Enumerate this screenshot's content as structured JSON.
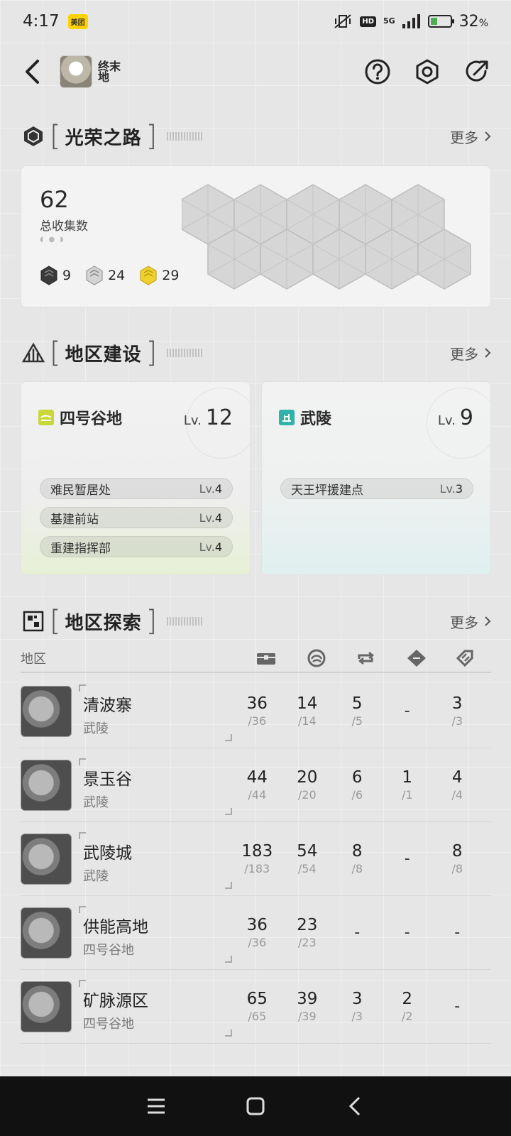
{
  "status_bar": {
    "time": "4:17",
    "app_badge": "美团",
    "hd": "HD",
    "network": "5G",
    "battery_percent": "32",
    "battery_unit": "%"
  },
  "header": {
    "game_logo_text": "终末地"
  },
  "glory": {
    "title": "光荣之路",
    "more": "更多",
    "total": "62",
    "total_label": "总收集数",
    "tiers": [
      {
        "icon": "dark-tier-icon",
        "count": "9",
        "color": "#3a3a3a"
      },
      {
        "icon": "silver-tier-icon",
        "count": "24",
        "color": "#c9c9c9"
      },
      {
        "icon": "gold-tier-icon",
        "count": "29",
        "color": "#f0d02c"
      }
    ]
  },
  "build": {
    "title": "地区建设",
    "more": "更多",
    "lv_prefix": "Lv.",
    "regions": [
      {
        "name": "四号谷地",
        "level": "12",
        "color": "#c8d83a",
        "facilities": [
          {
            "name": "难民暂居处",
            "lv_prefix": "Lv.",
            "level": "4"
          },
          {
            "name": "基建前站",
            "lv_prefix": "Lv.",
            "level": "4"
          },
          {
            "name": "重建指挥部",
            "lv_prefix": "Lv.",
            "level": "4"
          }
        ]
      },
      {
        "name": "武陵",
        "level": "9",
        "color": "#2fb3a8",
        "facilities": [
          {
            "name": "天王坪援建点",
            "lv_prefix": "Lv.",
            "level": "3"
          }
        ]
      }
    ]
  },
  "explore": {
    "title": "地区探索",
    "more": "更多",
    "region_header": "地区",
    "column_icons": [
      "chest-icon",
      "swirl-icon",
      "loop-icon",
      "diamond-icon",
      "tag-icon"
    ],
    "rows": [
      {
        "name": "清波寨",
        "area": "武陵",
        "cells": [
          {
            "v": "36",
            "t": "/36"
          },
          {
            "v": "14",
            "t": "/14"
          },
          {
            "v": "5",
            "t": "/5"
          },
          {
            "v": "-",
            "t": ""
          },
          {
            "v": "3",
            "t": "/3"
          }
        ]
      },
      {
        "name": "景玉谷",
        "area": "武陵",
        "cells": [
          {
            "v": "44",
            "t": "/44"
          },
          {
            "v": "20",
            "t": "/20"
          },
          {
            "v": "6",
            "t": "/6"
          },
          {
            "v": "1",
            "t": "/1"
          },
          {
            "v": "4",
            "t": "/4"
          }
        ]
      },
      {
        "name": "武陵城",
        "area": "武陵",
        "cells": [
          {
            "v": "183",
            "t": "/183"
          },
          {
            "v": "54",
            "t": "/54"
          },
          {
            "v": "8",
            "t": "/8"
          },
          {
            "v": "-",
            "t": ""
          },
          {
            "v": "8",
            "t": "/8"
          }
        ]
      },
      {
        "name": "供能高地",
        "area": "四号谷地",
        "cells": [
          {
            "v": "36",
            "t": "/36"
          },
          {
            "v": "23",
            "t": "/23"
          },
          {
            "v": "-",
            "t": ""
          },
          {
            "v": "-",
            "t": ""
          },
          {
            "v": "-",
            "t": ""
          }
        ]
      },
      {
        "name": "矿脉源区",
        "area": "四号谷地",
        "cells": [
          {
            "v": "65",
            "t": "/65"
          },
          {
            "v": "39",
            "t": "/39"
          },
          {
            "v": "3",
            "t": "/3"
          },
          {
            "v": "2",
            "t": "/2"
          },
          {
            "v": "-",
            "t": ""
          }
        ]
      }
    ]
  }
}
